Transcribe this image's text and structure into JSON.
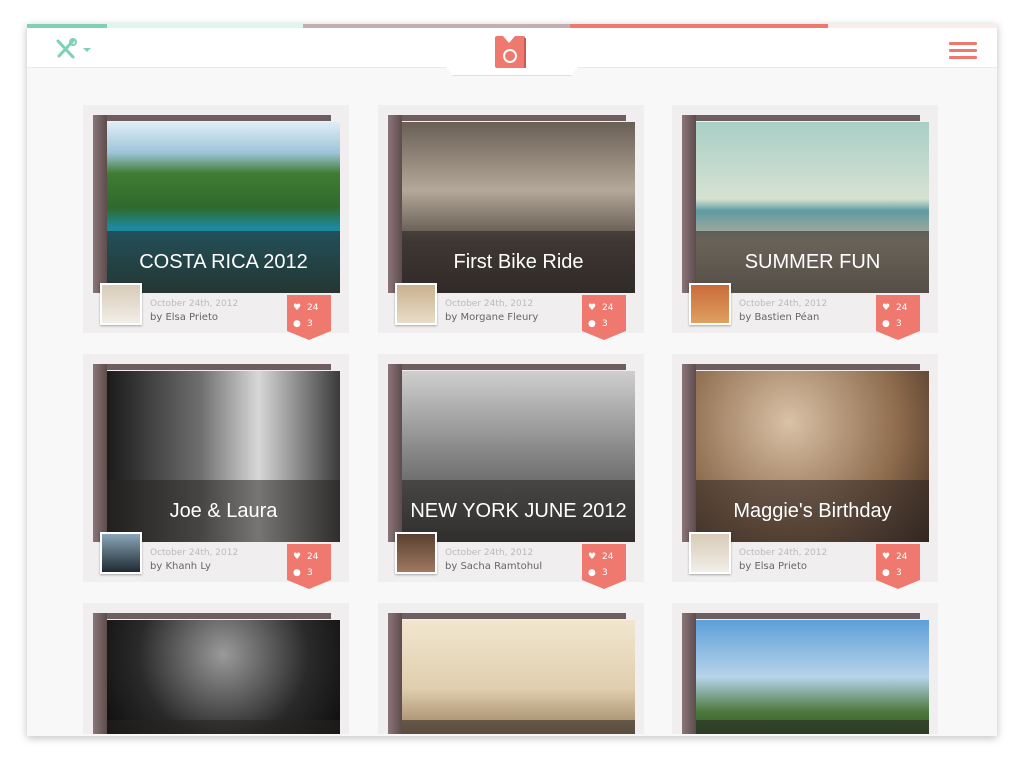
{
  "colors": {
    "accent": "#f0796f",
    "mint": "#7fd1b3",
    "mauve": "#c4aeb0"
  },
  "header": {
    "tools_icon": "wrench-screwdriver-icon",
    "logo_icon": "photo-book-icon",
    "menu_icon": "hamburger-icon"
  },
  "cards": [
    {
      "title": "COSTA RICA 2012",
      "date": "October 24th, 2012",
      "author": "by Elsa Prieto",
      "likes": "24",
      "comments": "3",
      "bg": "linear-gradient(180deg,#dfeef6 0%,#9ec4d8 18%,#3f7d34 30%,#2f6a2c 50%,#1c8aa0 62%,#1f4f46 100%)",
      "av": "linear-gradient(#d8cbb8,#f2eee8)"
    },
    {
      "title": "First Bike Ride",
      "date": "October 24th, 2012",
      "author": "by Morgane Fleury",
      "likes": "24",
      "comments": "3",
      "bg": "linear-gradient(180deg,#6a5f55,#b3a899 40%,#5a5048 70%,#3b342f)",
      "av": "linear-gradient(#c9b28f,#e9dcc8)"
    },
    {
      "title": "SUMMER FUN",
      "date": "October 24th, 2012",
      "author": "by Bastien Péan",
      "likes": "24",
      "comments": "3",
      "bg": "linear-gradient(180deg,#a9cfc6 0%,#d6e2d2 45%,#5f9aa0 52%,#b9b09a 70%,#8c8474 100%)",
      "av": "linear-gradient(#c96b3a,#e0a060)"
    },
    {
      "title": "Joe & Laura",
      "date": "October 24th, 2012",
      "author": "by Khanh Ly",
      "likes": "24",
      "comments": "3",
      "bg": "linear-gradient(90deg,#1a1a1a,#6e6e6e 40%,#d8d8d8 65%,#3a3a3a)",
      "av": "linear-gradient(#8aa6b8,#1e2a33)"
    },
    {
      "title": "NEW YORK JUNE 2012",
      "date": "October 24th, 2012",
      "author": "by Sacha Ramtohul",
      "likes": "24",
      "comments": "3",
      "bg": "linear-gradient(180deg,#cfcfcf,#8a8a8a 45%,#3c3c3c)",
      "av": "linear-gradient(#5a4030,#a07860)"
    },
    {
      "title": "Maggie's Birthday",
      "date": "October 24th, 2012",
      "author": "by Elsa Prieto",
      "likes": "24",
      "comments": "3",
      "bg": "radial-gradient(circle at 40% 30%,#d9c2a6,#8d6a4c 60%,#3e2c20)",
      "av": "linear-gradient(#d8cbb8,#f2eee8)"
    },
    {
      "title": "",
      "date": "",
      "author": "",
      "likes": "",
      "comments": "",
      "bg": "radial-gradient(circle at 50% 30%,#9a9a9a,#2a2a2a 60%,#0d0d0d)",
      "av": ""
    },
    {
      "title": "",
      "date": "",
      "author": "",
      "likes": "",
      "comments": "",
      "bg": "linear-gradient(180deg,#f1e6cf,#e0cfae 60%,#9a8060)",
      "av": ""
    },
    {
      "title": "",
      "date": "",
      "author": "",
      "likes": "",
      "comments": "",
      "bg": "linear-gradient(180deg,#5d9fd8,#b7d4ea 50%,#4d7a3e 80%,#2f5a2a)",
      "av": ""
    }
  ]
}
